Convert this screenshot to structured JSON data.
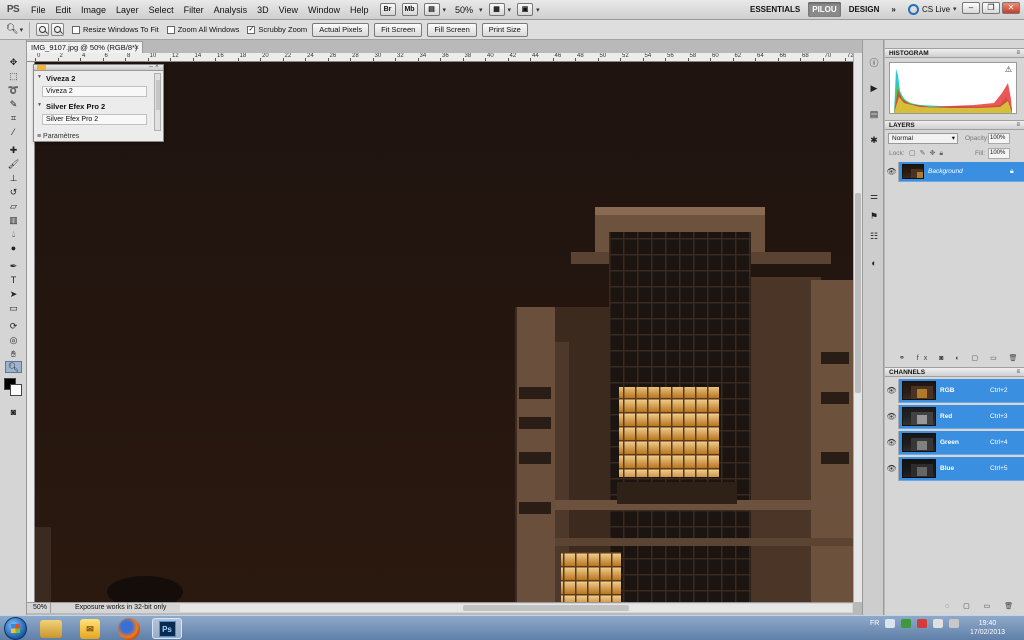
{
  "menubar": {
    "logo": "PS",
    "items": [
      "File",
      "Edit",
      "Image",
      "Layer",
      "Select",
      "Filter",
      "Analysis",
      "3D",
      "View",
      "Window",
      "Help"
    ],
    "br_label": "Br",
    "mb_label": "Mb",
    "zoom": "50%",
    "workspaces": [
      "ESSENTIALS",
      "PILOU",
      "DESIGN"
    ],
    "more": "»",
    "cslive": "CS Live"
  },
  "options": {
    "checks": [
      {
        "label": "Resize Windows To Fit",
        "checked": false
      },
      {
        "label": "Zoom All Windows",
        "checked": false
      },
      {
        "label": "Scrubby Zoom",
        "checked": true
      }
    ],
    "buttons": [
      "Actual Pixels",
      "Fit Screen",
      "Fill Screen",
      "Print Size"
    ]
  },
  "document": {
    "tab_title": "IMG_9107.jpg @ 50% (RGB/8*)",
    "zoom": "50%",
    "status": "Exposure works in 32-bit only"
  },
  "ruler": {
    "labels": [
      "0",
      "2",
      "4",
      "6",
      "8",
      "10",
      "12",
      "14",
      "16",
      "18",
      "20",
      "22",
      "24",
      "26",
      "28",
      "30",
      "32",
      "34",
      "36",
      "38",
      "40",
      "42",
      "44",
      "46",
      "48",
      "50",
      "52",
      "54",
      "56",
      "58",
      "60",
      "62",
      "64",
      "66",
      "68",
      "70",
      "72"
    ]
  },
  "plugin_panel": {
    "sections": [
      {
        "header": "Viveza 2",
        "item": "Viveza 2"
      },
      {
        "header": "Silver Efex Pro 2",
        "item": "Silver Efex Pro 2"
      }
    ],
    "footer": "Paramètres"
  },
  "panels": {
    "histogram": {
      "title": "HISTOGRAM",
      "warning": "⚠"
    },
    "layers": {
      "title": "LAYERS",
      "blend_mode": "Normal",
      "opacity_label": "Opacity:",
      "opacity": "100%",
      "lock_label": "Lock:",
      "fill_label": "Fill:",
      "fill": "100%",
      "layer_name": "Background"
    },
    "channels": {
      "title": "CHANNELS",
      "rows": [
        {
          "name": "RGB",
          "shortcut": "Ctrl+2"
        },
        {
          "name": "Red",
          "shortcut": "Ctrl+3"
        },
        {
          "name": "Green",
          "shortcut": "Ctrl+4"
        },
        {
          "name": "Blue",
          "shortcut": "Ctrl+5"
        }
      ]
    }
  },
  "taskbar": {
    "lang": "FR",
    "time": "19:40",
    "date": "17/02/2013",
    "ps_label": "Ps"
  },
  "colors": {
    "selection_blue": "#3b8fe0",
    "canvas_sky": "#24140f",
    "panel_gray": "#d6d6d6"
  }
}
